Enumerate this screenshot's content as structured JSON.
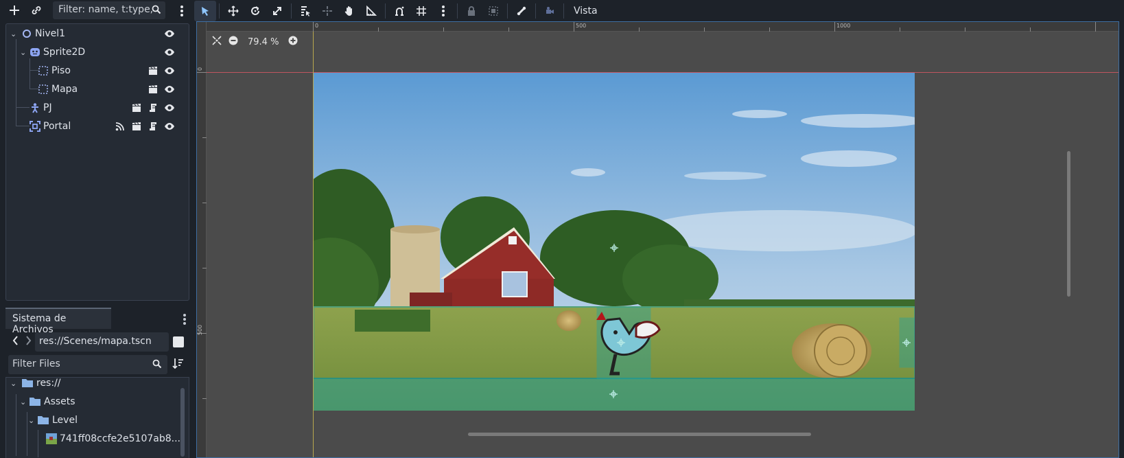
{
  "scene_dock": {
    "filter_placeholder": "Filter: name, t:type,",
    "tree": [
      {
        "label": "Nivel1"
      },
      {
        "label": "Sprite2D"
      },
      {
        "label": "Piso"
      },
      {
        "label": "Mapa"
      },
      {
        "label": "PJ"
      },
      {
        "label": "Portal"
      }
    ]
  },
  "filesystem": {
    "tab_label": "Sistema de Archivos",
    "path": "res://Scenes/mapa.tscn",
    "filter_placeholder": "Filter Files",
    "tree": [
      {
        "label": "res://"
      },
      {
        "label": "Assets"
      },
      {
        "label": "Level"
      },
      {
        "label": "741ff08ccfe2e5107ab8..."
      }
    ]
  },
  "toolbar": {
    "view_menu_label": "Vista"
  },
  "viewport": {
    "zoom_label": "79.4 %",
    "ruler_top": [
      "0",
      "500",
      "1000"
    ],
    "ruler_left": [
      "0",
      "500"
    ],
    "accent_colors": {
      "guide_origin_y": "#c0555f",
      "guide_origin_x": "#b9a84e",
      "collision": "#2aa198"
    }
  }
}
